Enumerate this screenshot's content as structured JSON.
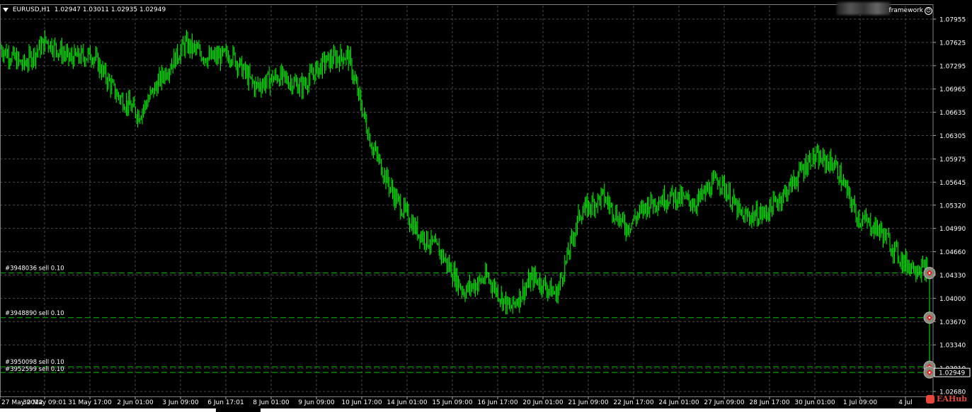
{
  "header": {
    "symbol": "EURUSD,H1",
    "ohlc": "1.02947 1.03011 1.02935 1.02949",
    "framework_label": "framework",
    "framework_icon": "smiley-icon"
  },
  "branding": {
    "label": "EAHub",
    "icon": "eahub-logo-icon",
    "color": "#e8463a"
  },
  "colors": {
    "background": "#000000",
    "candle": "#00ff00",
    "grid": "#4a4a4a",
    "order_line": "#00c000",
    "axis_text": "#ffffff"
  },
  "chart_data": {
    "type": "line",
    "title": "",
    "xlabel": "",
    "ylabel": "",
    "ylim": [
      1.0268,
      1.0812
    ],
    "grid": true,
    "y_ticks": [
      "1.07955",
      "1.07625",
      "1.07295",
      "1.06965",
      "1.06635",
      "1.06305",
      "1.05975",
      "1.05645",
      "1.05320",
      "1.04990",
      "1.04660",
      "1.04330",
      "1.04000",
      "1.03670",
      "1.03340",
      "1.03010",
      "1.02680"
    ],
    "x_ticks": [
      "27 May 2022",
      "30 May 09:01",
      "31 May 17:00",
      "2 Jun 01:00",
      "3 Jun 09:00",
      "6 Jun 17:01",
      "8 Jun 01:00",
      "9 Jun 09:00",
      "10 Jun 17:00",
      "14 Jun 01:00",
      "15 Jun 09:00",
      "16 Jun 17:00",
      "20 Jun 01:00",
      "21 Jun 09:00",
      "22 Jun 17:00",
      "24 Jun 01:00",
      "27 Jun 09:00",
      "28 Jun 17:00",
      "30 Jun 01:00",
      "1 Jul 09:00",
      "4 Jul"
    ],
    "series": [
      {
        "type": "price",
        "x_index": [
          0,
          8,
          16,
          24,
          32,
          40,
          48,
          56,
          64,
          72,
          80,
          88,
          96,
          104,
          112,
          120,
          128,
          136,
          144,
          152,
          160,
          168,
          176,
          184,
          192,
          200,
          208,
          216,
          224,
          232,
          240,
          248,
          256,
          264,
          272,
          280,
          288,
          296,
          304,
          312,
          320
        ],
        "values": [
          1.0755,
          1.073,
          1.0765,
          1.074,
          1.0745,
          1.069,
          1.066,
          1.0715,
          1.076,
          1.074,
          1.0745,
          1.07,
          1.0715,
          1.07,
          1.0735,
          1.0745,
          1.062,
          1.0545,
          1.0495,
          1.0465,
          1.041,
          1.043,
          1.0385,
          1.043,
          1.0405,
          1.052,
          1.0545,
          1.05,
          1.0535,
          1.0545,
          1.0535,
          1.057,
          1.0515,
          1.052,
          1.0555,
          1.06,
          1.059,
          1.0515,
          1.0495,
          1.045,
          1.044
        ]
      }
    ],
    "last_price": "1.02949",
    "orders": [
      {
        "label": "#3948036 sell 0.10",
        "price": 1.04358
      },
      {
        "label": "#3948890 sell 0.10",
        "price": 1.03725
      },
      {
        "label": "#3950098 sell 0.10",
        "price": 1.0303
      },
      {
        "label": "#3952599 sell 0.10",
        "price": 1.02949
      }
    ]
  }
}
